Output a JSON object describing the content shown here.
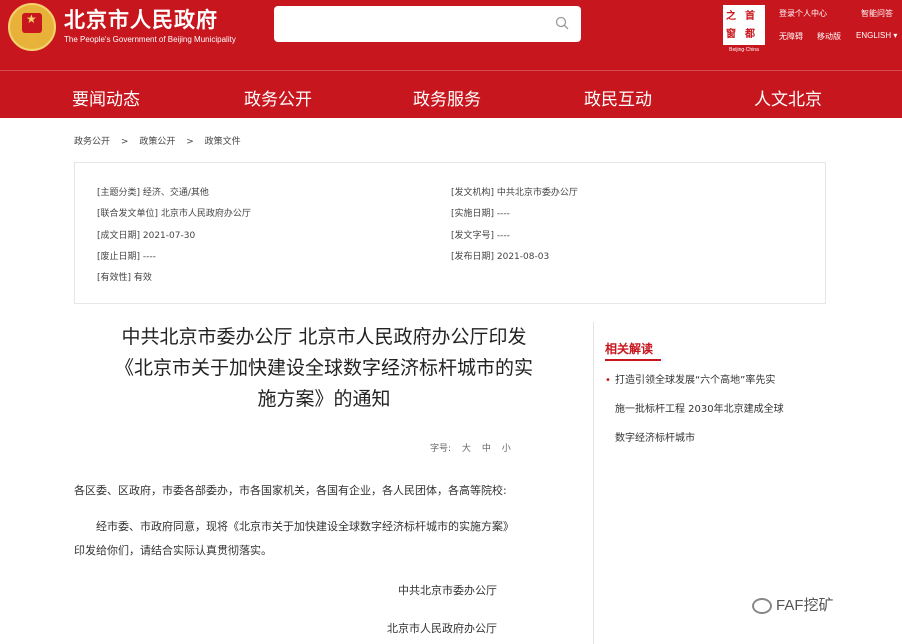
{
  "header": {
    "site_title": "北京市人民政府",
    "site_subtitle": "The People's Government of Beijing Municipality",
    "search_placeholder": "",
    "logo_chars": [
      "之",
      "首",
      "窗",
      "都"
    ],
    "logo_caption": "Beijing·China",
    "links": {
      "login": "登录个人中心",
      "assistant": "智能问答",
      "accessibility": "无障碍",
      "mobile": "移动版",
      "english": "ENGLISH ▾"
    }
  },
  "nav": [
    "要闻动态",
    "政务公开",
    "政务服务",
    "政民互动",
    "人文北京"
  ],
  "breadcrumb": [
    "政务公开",
    ">",
    "政策公开",
    ">",
    "政策文件"
  ],
  "meta": {
    "category": "[主题分类] 经济、交通/其他",
    "joint_unit": "[联合发文单位] 北京市人民政府办公厅",
    "written_date": "[成文日期] 2021-07-30",
    "abolished_date": "[废止日期] ----",
    "validity": "[有效性] 有效",
    "issuer": "[发文机构] 中共北京市委办公厅",
    "effective_date": "[实施日期] ----",
    "doc_number": "[发文字号] ----",
    "publish_date": "[发布日期] 2021-08-03"
  },
  "article": {
    "title_lines": [
      "中共北京市委办公厅 北京市人民政府办公厅印发",
      "《北京市关于加快建设全球数字经济标杆城市的实",
      "施方案》的通知"
    ],
    "font_size_label": "字号:",
    "font_sizes": [
      "大",
      "中",
      "小"
    ],
    "salutation": "各区委、区政府，市委各部委办，市各国家机关，各国有企业，各人民团体，各高等院校:",
    "body_line1": "经市委、市政府同意，现将《北京市关于加快建设全球数字经济标杆城市的实施方案》",
    "body_line2": "印发给你们，请结合实际认真贯彻落实。",
    "signature1": "中共北京市委办公厅",
    "signature2": "北京市人民政府办公厅"
  },
  "sidebar": {
    "title": "相关解读",
    "bullet": "•",
    "item_lines": [
      "打造引领全球发展“六个高地”率先实",
      "施一批标杆工程 2030年北京建成全球",
      "数字经济标杆城市"
    ]
  },
  "watermark": "FAF挖矿",
  "colors": {
    "brand_red": "#c8161e",
    "emblem_gold": "#e8b23a"
  }
}
